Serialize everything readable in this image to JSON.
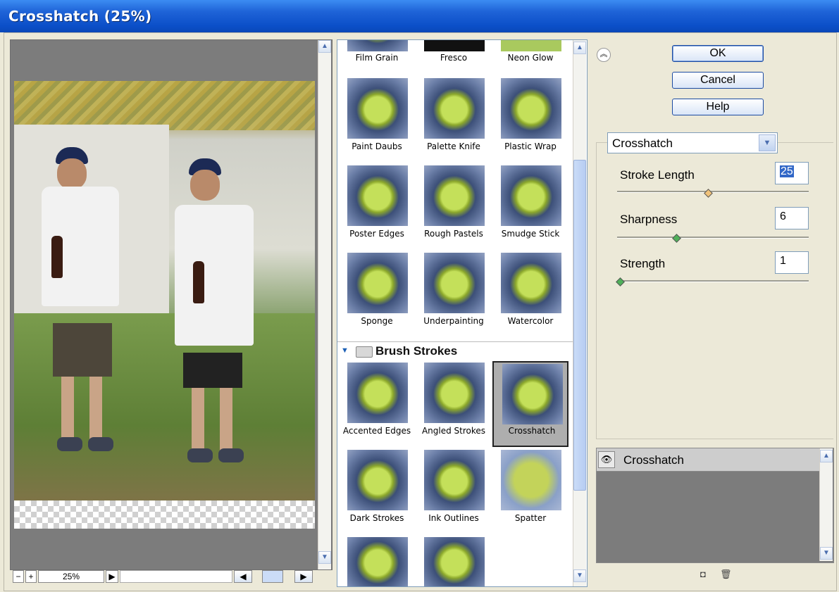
{
  "window": {
    "title": "Crosshatch (25%)"
  },
  "preview": {
    "zoom_minus": "−",
    "zoom_plus": "+",
    "zoom_value": "25%",
    "zoom_menu_icon": "triangle-right-icon"
  },
  "gallery": {
    "top_row": [
      "Film Grain",
      "Fresco",
      "Neon Glow"
    ],
    "artistic_rows": [
      [
        "Paint Daubs",
        "Palette Knife",
        "Plastic Wrap"
      ],
      [
        "Poster Edges",
        "Rough Pastels",
        "Smudge Stick"
      ],
      [
        "Sponge",
        "Underpainting",
        "Watercolor"
      ]
    ],
    "group_name": "Brush Strokes",
    "brush_rows": [
      [
        "Accented Edges",
        "Angled Strokes",
        "Crosshatch"
      ],
      [
        "Dark Strokes",
        "Ink Outlines",
        "Spatter"
      ]
    ],
    "selected": "Crosshatch"
  },
  "buttons": {
    "ok": "OK",
    "cancel": "Cancel",
    "help": "Help"
  },
  "filter_select": {
    "value": "Crosshatch"
  },
  "params": [
    {
      "label": "Stroke Length",
      "value": "25",
      "level_fraction": 0.5
    },
    {
      "label": "Sharpness",
      "value": "6",
      "level_fraction": 0.3
    },
    {
      "label": "Strength",
      "value": "1",
      "level_fraction": 0.0
    }
  ],
  "layers": [
    {
      "name": "Crosshatch",
      "visible": true
    }
  ],
  "colors": {
    "title_bar": "#0b4fc8",
    "selection": "#3167c7"
  }
}
